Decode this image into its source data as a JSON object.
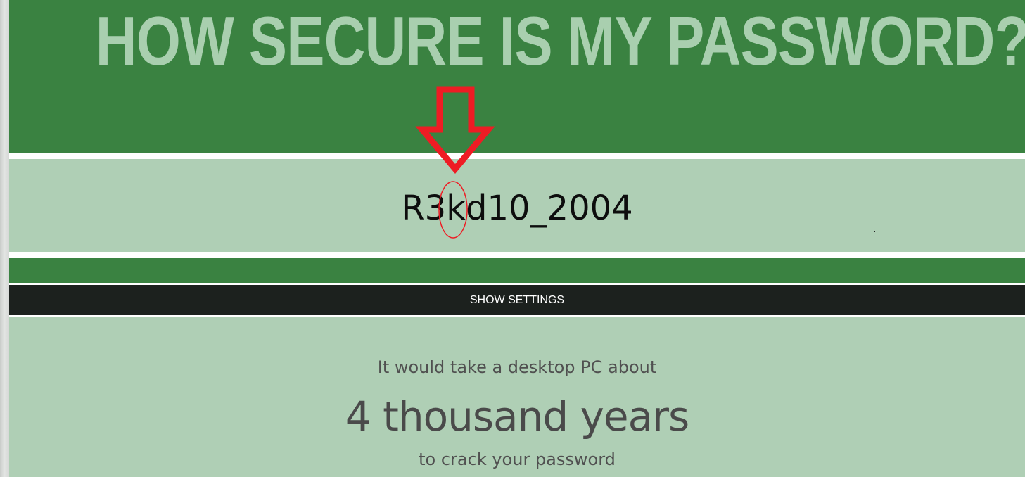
{
  "page": {
    "title": "HOW SECURE IS MY PASSWORD?",
    "password_value": "R3kd10_2004",
    "settings_label": "SHOW SETTINGS",
    "result": {
      "intro": "It would take a desktop PC about",
      "duration": "4 thousand years",
      "outro": "to crack your password"
    }
  },
  "colors": {
    "header_green": "#3a8241",
    "title_text": "#a9cfaf",
    "light_green": "#afcfb5",
    "settings_bar": "#1c211e",
    "annotation_red": "#ee1c24"
  },
  "annotation": {
    "arrow_icon": "red-down-arrow-icon",
    "highlight_icon": "red-ellipse-highlight-icon"
  }
}
